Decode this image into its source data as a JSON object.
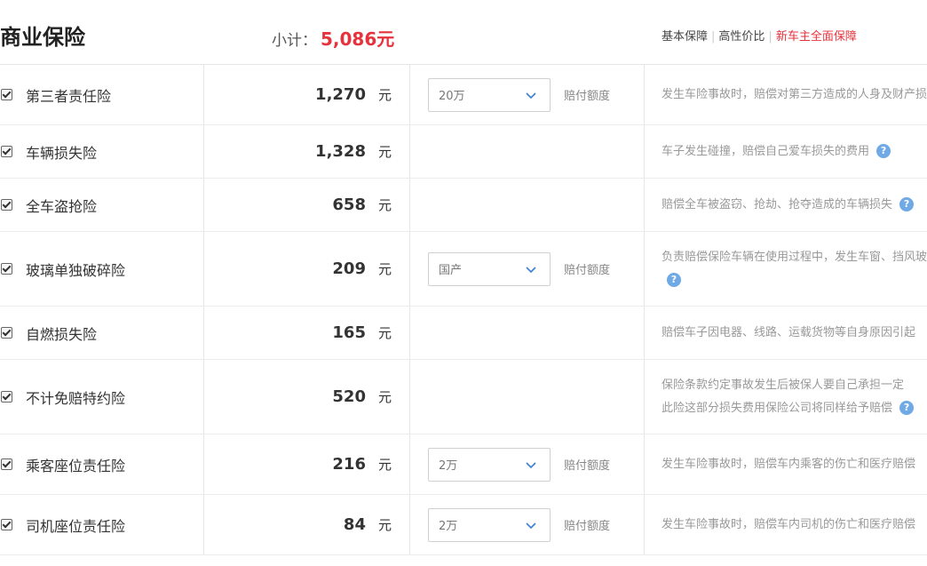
{
  "header": {
    "title": "商业保险",
    "subtotal_label": "小计：",
    "subtotal_amount": "5,086元",
    "tabs": [
      {
        "label": "基本保障",
        "active": false
      },
      {
        "label": "高性价比",
        "active": false
      },
      {
        "label": "新车主全面保障",
        "active": true
      }
    ]
  },
  "unit": "元",
  "limit_label": "赔付额度",
  "rows": [
    {
      "name": "第三者责任险",
      "price": "1,270",
      "select": "20万",
      "desc": [
        "发生车险事故时，赔偿对第三方造成的人身及财产损失"
      ],
      "help": false
    },
    {
      "name": "车辆损失险",
      "price": "1,328",
      "select": null,
      "desc": [
        "车子发生碰撞，赔偿自己爱车损失的费用"
      ],
      "help": true
    },
    {
      "name": "全车盗抢险",
      "price": "658",
      "select": null,
      "desc": [
        "赔偿全车被盗窃、抢劫、抢夺造成的车辆损失"
      ],
      "help": true
    },
    {
      "name": "玻璃单独破碎险",
      "price": "209",
      "select": "国产",
      "desc": [
        "负责赔偿保险车辆在使用过程中，发生车窗、挡风玻璃",
        ""
      ],
      "help": true
    },
    {
      "name": "自燃损失险",
      "price": "165",
      "select": null,
      "desc": [
        "赔偿车子因电器、线路、运载货物等自身原因引起"
      ],
      "help": false
    },
    {
      "name": "不计免赔特约险",
      "price": "520",
      "select": null,
      "desc": [
        "保险条款约定事故发生后被保人要自己承担一定",
        "此险这部分损失费用保险公司将同样给予赔偿"
      ],
      "help": true
    },
    {
      "name": "乘客座位责任险",
      "price": "216",
      "select": "2万",
      "desc": [
        "发生车险事故时，赔偿车内乘客的伤亡和医疗赔偿"
      ],
      "help": false
    },
    {
      "name": "司机座位责任险",
      "price": "84",
      "select": "2万",
      "desc": [
        "发生车险事故时，赔偿车内司机的伤亡和医疗赔偿"
      ],
      "help": false
    }
  ]
}
